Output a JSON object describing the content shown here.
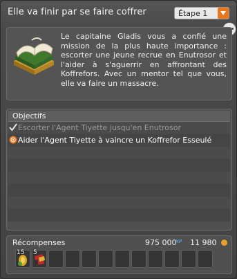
{
  "window": {
    "title": "Elle va finir par se faire coffrer",
    "step_select": {
      "selected": "Étape 1"
    }
  },
  "description": {
    "text": "Le capitaine Gladis vous a confié une mission de la plus haute importance : escorter une jeune recrue en Enutrosor et l'aider à s'aguerrir en affrontant des Koffrefors. Avec un mentor tel que vous, elle va faire un massacre."
  },
  "objectives": {
    "header": "Objectifs",
    "items": [
      {
        "label": "Escorter l'Agent Tiyette jusqu'en Enutrosor",
        "status": "done",
        "icon": "check-icon"
      },
      {
        "label": "Aider l'Agent Tiyette à vaincre un Koffrefor Esseulé",
        "status": "active",
        "icon": "target-icon"
      }
    ]
  },
  "rewards": {
    "label": "Récompenses",
    "xp": "975 000",
    "xp_unit": "XP",
    "kamas": "11 980",
    "items": [
      {
        "qty": "15",
        "icon": "gold-coin-item-icon"
      },
      {
        "qty": "5",
        "icon": "red-parchment-item-icon"
      }
    ],
    "empty_slots": 10
  },
  "colors": {
    "accent_orange": "#e8771d",
    "xp_blue": "#5fb7ff",
    "kamas_gold": "#e8a12b"
  }
}
